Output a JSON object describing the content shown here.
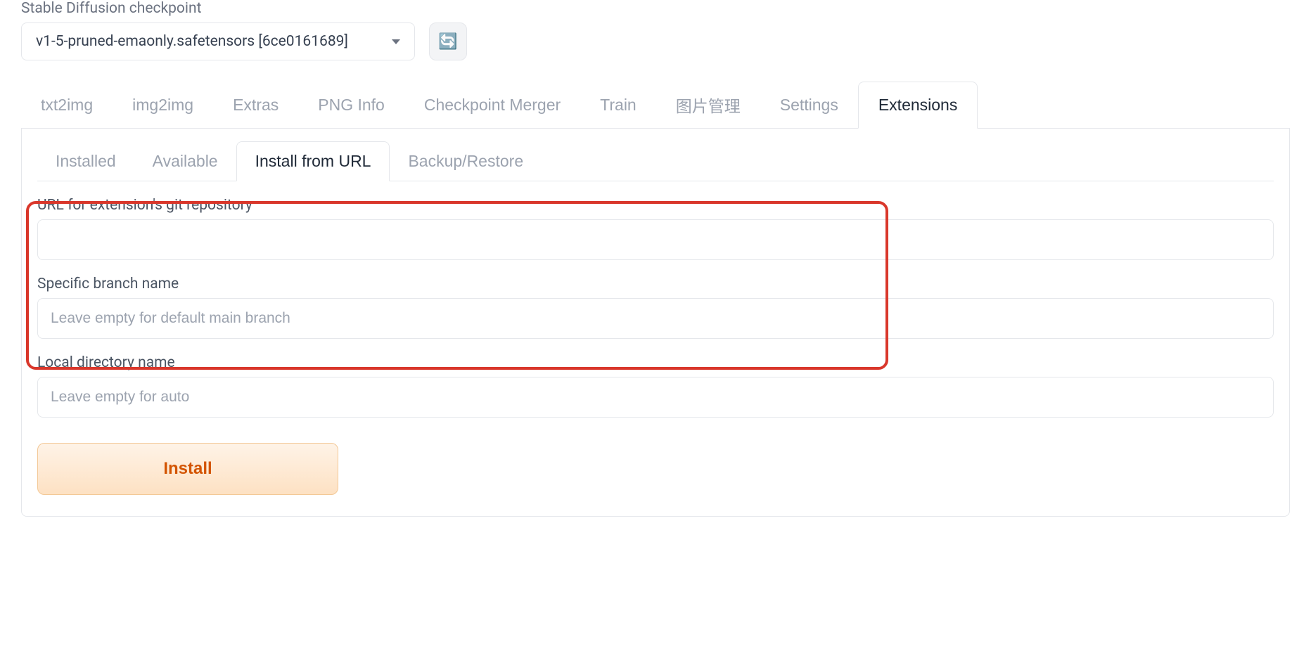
{
  "checkpoint": {
    "label": "Stable Diffusion checkpoint",
    "value": "v1-5-pruned-emaonly.safetensors [6ce0161689]"
  },
  "main_tabs": [
    {
      "label": "txt2img",
      "active": false
    },
    {
      "label": "img2img",
      "active": false
    },
    {
      "label": "Extras",
      "active": false
    },
    {
      "label": "PNG Info",
      "active": false
    },
    {
      "label": "Checkpoint Merger",
      "active": false
    },
    {
      "label": "Train",
      "active": false
    },
    {
      "label": "图片管理",
      "active": false
    },
    {
      "label": "Settings",
      "active": false
    },
    {
      "label": "Extensions",
      "active": true
    }
  ],
  "sub_tabs": [
    {
      "label": "Installed",
      "active": false
    },
    {
      "label": "Available",
      "active": false
    },
    {
      "label": "Install from URL",
      "active": true
    },
    {
      "label": "Backup/Restore",
      "active": false
    }
  ],
  "form": {
    "url_label": "URL for extension's git repository",
    "url_value": "",
    "branch_label": "Specific branch name",
    "branch_placeholder": "Leave empty for default main branch",
    "branch_value": "",
    "localdir_label": "Local directory name",
    "localdir_placeholder": "Leave empty for auto",
    "localdir_value": "",
    "install_label": "Install"
  },
  "icons": {
    "refresh": "🔄"
  }
}
